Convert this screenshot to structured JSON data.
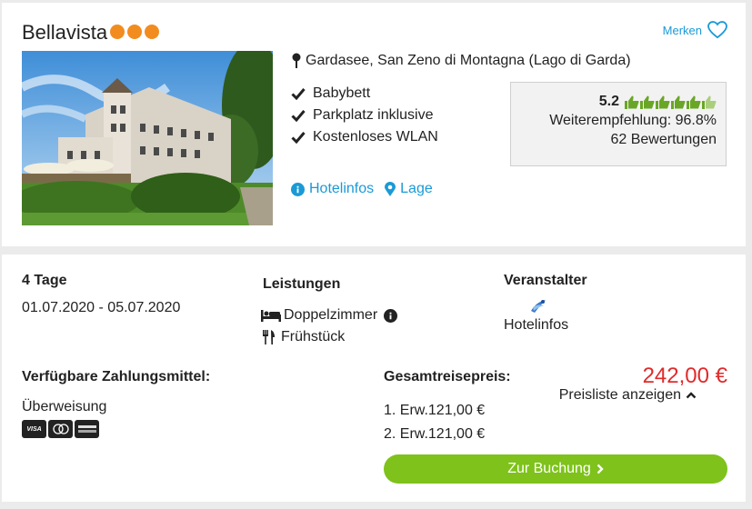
{
  "hotel": {
    "name": "Bellavista",
    "category_dots": 3,
    "merken_label": "Merken",
    "location": "Gardasee, San Zeno di Montagna (Lago di Garda)",
    "features": [
      "Babybett",
      "Parkplatz inklusive",
      "Kostenloses WLAN"
    ],
    "links": {
      "hotelinfos": "Hotelinfos",
      "lage": "Lage"
    }
  },
  "rating": {
    "value": "5.2",
    "thumbs_filled": 5.5,
    "thumbs_total": 6,
    "recommendation": "Weiterempfehlung: 96.8%",
    "reviews": "62 Bewertungen"
  },
  "offer": {
    "duration": "4 Tage",
    "dates": "01.07.2020 - 05.07.2020",
    "services_title": "Leistungen",
    "room": "Doppelzimmer",
    "board": "Frühstück",
    "operator_title": "Veranstalter",
    "operator_link": "Hotelinfos",
    "payment_title": "Verfügbare Zahlungsmittel:",
    "payment_method": "Überweisung",
    "payment_cards": [
      "VISA",
      "Mastercard",
      "American Express"
    ],
    "total_title": "Gesamtreisepreis:",
    "price": "242,00 €",
    "price_list_label": "Preisliste anzeigen",
    "pax": [
      "1. Erw.121,00 €",
      "2. Erw.121,00 €"
    ],
    "book_label": "Zur Buchung"
  },
  "colors": {
    "accent": "#1a9ad6",
    "price": "#e02b2b",
    "button": "#7ec21b",
    "category_dot": "#f28c1f",
    "thumb": "#6aa625"
  }
}
